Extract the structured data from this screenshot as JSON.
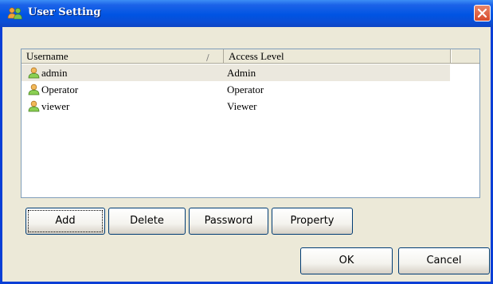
{
  "window": {
    "title": "User Setting"
  },
  "list": {
    "columns": [
      "Username",
      "Access Level",
      ""
    ],
    "sort_indicator": "/",
    "rows": [
      {
        "username": "admin",
        "level": "Admin",
        "selected": true
      },
      {
        "username": "Operator",
        "level": "Operator",
        "selected": false
      },
      {
        "username": "viewer",
        "level": "Viewer",
        "selected": false
      }
    ]
  },
  "actions": {
    "add": "Add",
    "delete": "Delete",
    "password": "Password",
    "property": "Property"
  },
  "footer": {
    "ok": "OK",
    "cancel": "Cancel"
  },
  "colors": {
    "titlebar": "#0054e3",
    "face": "#ece9d8",
    "selection": "#ebe8de",
    "close": "#d74a2a"
  },
  "icons": {
    "title": "users-icon",
    "row": "user-icon",
    "close": "close-icon"
  }
}
